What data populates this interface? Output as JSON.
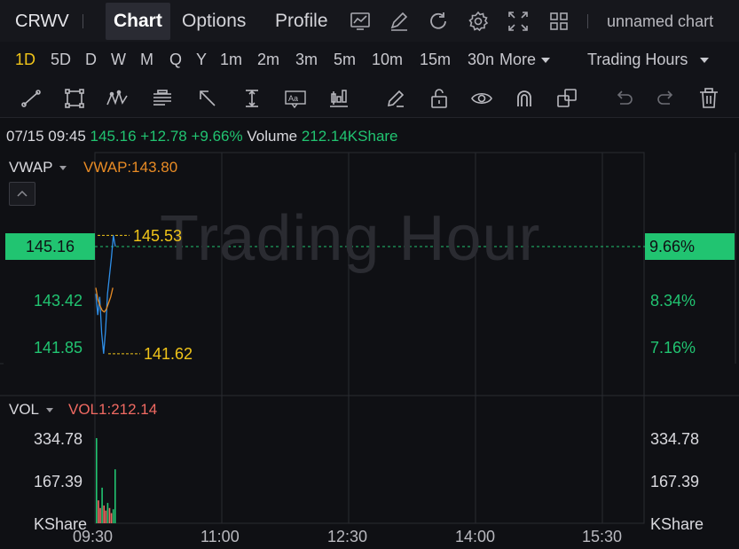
{
  "header": {
    "ticker": "CRWV",
    "tabs": [
      {
        "label": "Chart",
        "active": true
      },
      {
        "label": "Options",
        "active": false
      },
      {
        "label": "Profile",
        "active": false
      }
    ],
    "icons": [
      "chart-settings-icon",
      "draw-pen-icon",
      "refresh-icon",
      "gear-icon",
      "fullscreen-icon",
      "layout-grid-icon"
    ],
    "chart_name": "unnamed chart"
  },
  "periods": {
    "items": [
      "1D",
      "5D",
      "D",
      "W",
      "M",
      "Q",
      "Y",
      "1m",
      "2m",
      "3m",
      "5m",
      "10m",
      "15m",
      "30n"
    ],
    "active": "1D",
    "more_label": "More",
    "session_label": "Trading Hours"
  },
  "drawing_tools": [
    "trend-line-icon",
    "rectangle-icon",
    "pattern-icon",
    "text-note-icon",
    "arrow-icon",
    "price-range-icon",
    "text-box-icon",
    "candle-icon",
    "pen-icon",
    "unlock-icon",
    "eye-icon",
    "magnet-icon",
    "copy-icon",
    "undo-icon",
    "redo-icon",
    "trash-icon"
  ],
  "info": {
    "datetime": "07/15 09:45",
    "price": "145.16",
    "change": "+12.78",
    "change_pct": "+9.66%",
    "volume_label": "Volume",
    "volume_value": "212.14KShare"
  },
  "indicator": {
    "name": "VWAP",
    "value_text": "VWAP:143.80"
  },
  "watermark": "Trading Hour",
  "price_axis": {
    "current_price": "145.16",
    "current_pct": "9.66%",
    "left_ticks": [
      "143.42",
      "141.85"
    ],
    "right_ticks": [
      "8.34%",
      "7.16%"
    ],
    "high_label": "145.53",
    "low_label": "141.62"
  },
  "volume_pane": {
    "name": "VOL",
    "value_text": "VOL1:212.14",
    "left_ticks": [
      "334.78",
      "167.39",
      "KShare"
    ],
    "right_ticks": [
      "334.78",
      "167.39",
      "KShare"
    ]
  },
  "time_axis": [
    "09:30",
    "11:00",
    "12:30",
    "14:00",
    "15:30"
  ],
  "colors": {
    "up": "#21c471",
    "down": "#f06a62",
    "price_line": "#2f8fe8",
    "vwap_line": "#e88b25",
    "highlight": "#f0c419"
  },
  "chart_data": {
    "type": "line",
    "series": [
      {
        "name": "Price",
        "values": [
          143.6,
          142.9,
          143.5,
          142.3,
          141.62,
          142.4,
          143.6,
          144.2,
          144.8,
          145.53,
          145.16
        ]
      },
      {
        "name": "VWAP",
        "values": [
          143.8,
          143.4,
          143.2,
          143.05,
          143.0,
          143.1,
          143.3,
          143.5,
          143.8
        ]
      }
    ],
    "volume_values": [
      334.78,
      90,
      60,
      140,
      70,
      50,
      80,
      60,
      40,
      55,
      212.14
    ],
    "x": [
      "09:30",
      "11:00",
      "12:30",
      "14:00",
      "15:30"
    ],
    "ylim": [
      141.0,
      146.0
    ],
    "grid": true
  }
}
